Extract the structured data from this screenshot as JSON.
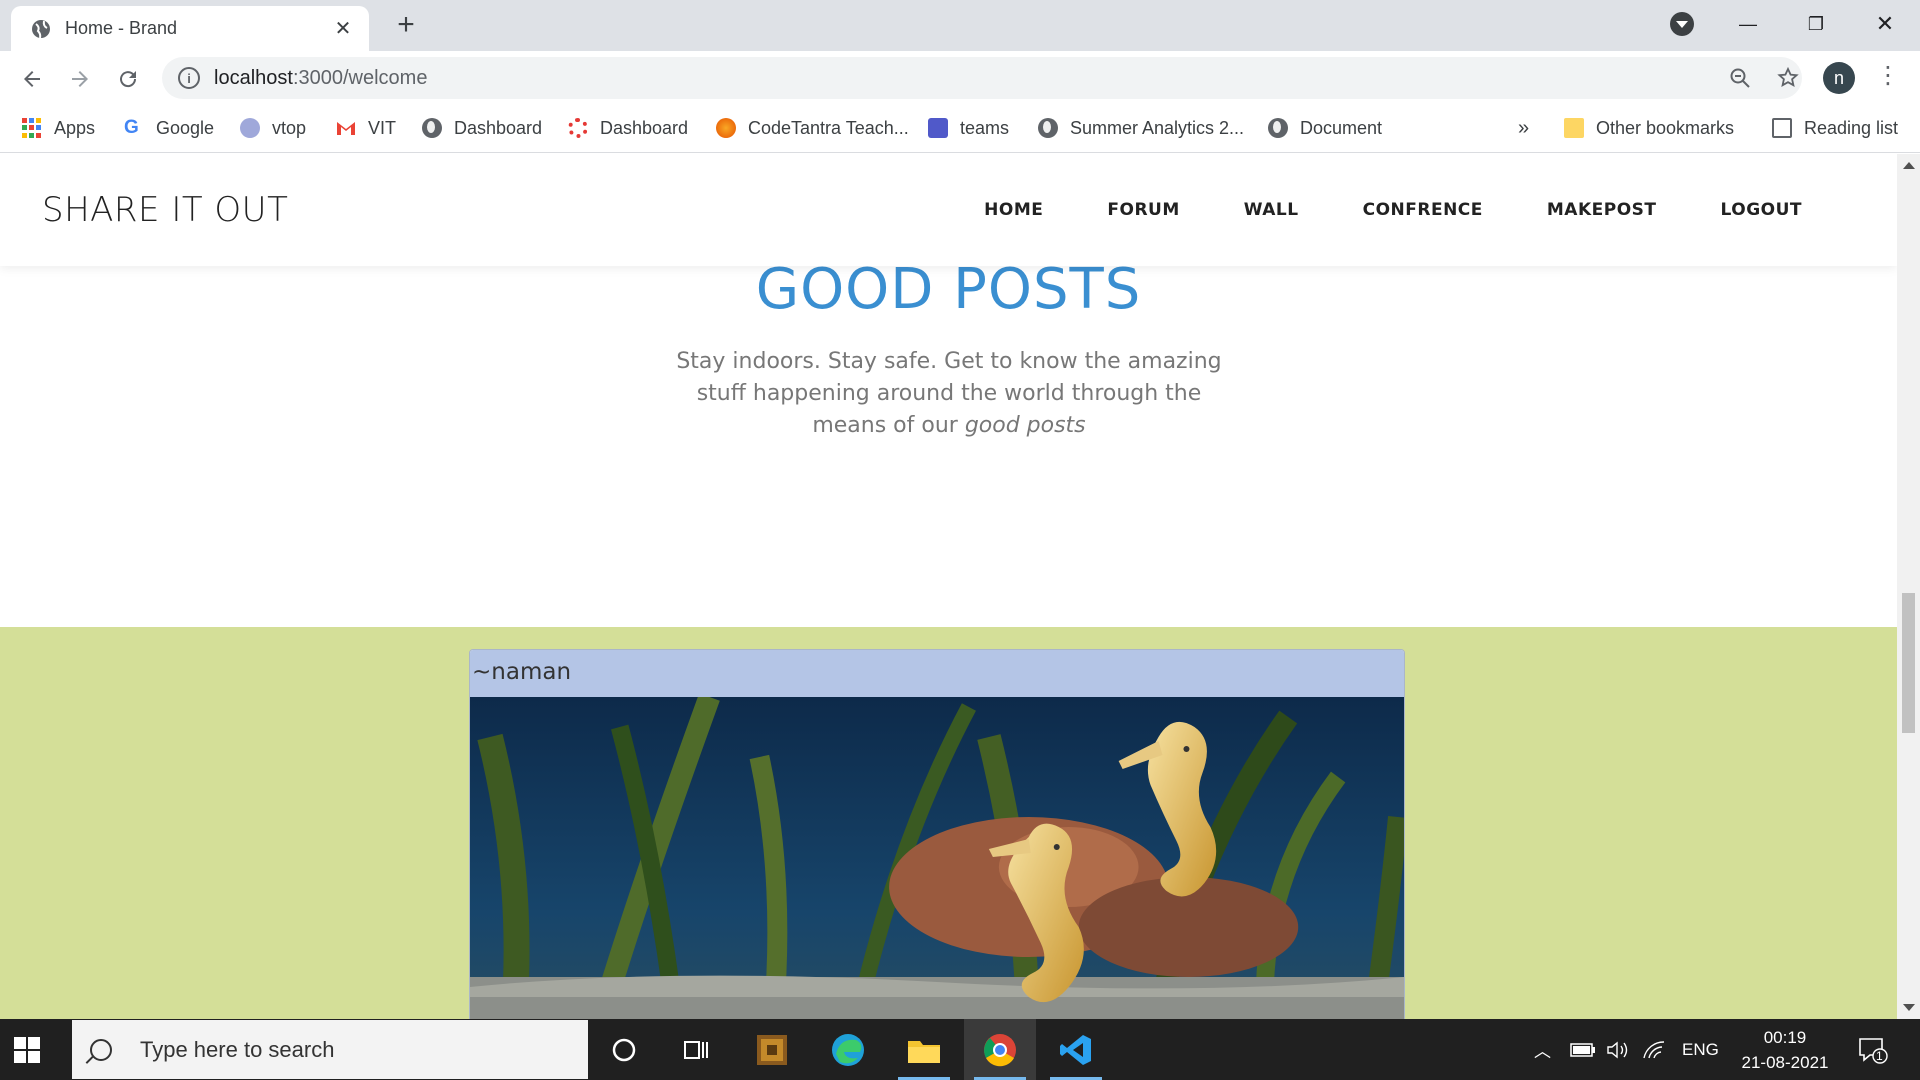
{
  "browser": {
    "tab_title": "Home - Brand",
    "tab_close": "✕",
    "new_tab": "+",
    "url_host": "localhost",
    "url_path": ":3000/welcome",
    "profile_initial": "n",
    "window_controls": {
      "minimize": "—",
      "restore": "❐",
      "close": "✕"
    }
  },
  "bookmarks": {
    "items": [
      {
        "label": "Apps",
        "icon": "apps-grid-icon"
      },
      {
        "label": "Google",
        "icon": "google-icon"
      },
      {
        "label": "vtop",
        "icon": "vtop-icon"
      },
      {
        "label": "VIT",
        "icon": "gmail-icon"
      },
      {
        "label": "Dashboard",
        "icon": "globe-icon"
      },
      {
        "label": "Dashboard",
        "icon": "dashboard-flower-icon"
      },
      {
        "label": "CodeTantra Teach...",
        "icon": "codetantra-icon"
      },
      {
        "label": "teams",
        "icon": "teams-icon"
      },
      {
        "label": "Summer Analytics 2...",
        "icon": "globe-icon"
      },
      {
        "label": "Document",
        "icon": "globe-icon"
      }
    ],
    "overflow": "»",
    "other_bookmarks": "Other bookmarks",
    "reading_list": "Reading list"
  },
  "site": {
    "brand": "SHARE IT OUT",
    "nav": [
      "HOME",
      "FORUM",
      "WALL",
      "CONFRENCE",
      "MAKEPOST",
      "LOGOUT"
    ]
  },
  "hero": {
    "title": "GOOD POSTS",
    "text_main": "Stay indoors. Stay safe. Get to know the amazing stuff happening around the world through the means of our ",
    "text_em": "good posts"
  },
  "posts": [
    {
      "author": "~naman",
      "image": "seahorses-aquarium-photo"
    }
  ],
  "taskbar": {
    "search_placeholder": "Type here to search",
    "language": "ENG",
    "time": "00:19",
    "date": "21-08-2021",
    "notifications": "1"
  },
  "colors": {
    "hero_title": "#3a8fd1",
    "post_section_bg": "#d4df98",
    "post_header_bg": "#b4c5e6"
  }
}
